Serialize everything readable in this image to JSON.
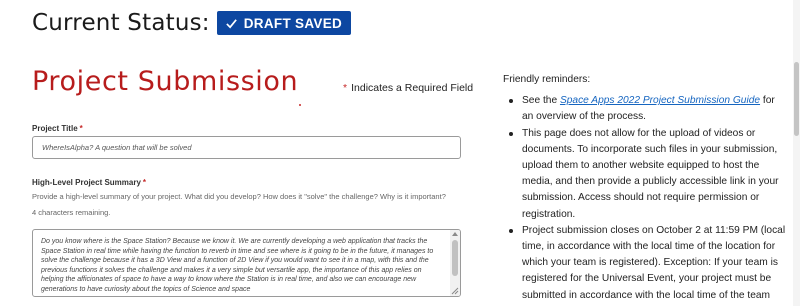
{
  "status": {
    "label": "Current Status:",
    "badge": "DRAFT SAVED",
    "badge_icon": "check-icon",
    "badge_color": "#0d47a1"
  },
  "page_title": "Project Submission",
  "required_note": {
    "star": "*",
    "text": "Indicates a Required Field"
  },
  "form": {
    "project_title": {
      "label": "Project Title",
      "star": "*",
      "value": "WhereIsAlpha? A question that will be solved"
    },
    "summary": {
      "label": "High-Level Project Summary",
      "star": "*",
      "helper": "Provide a high-level summary of your project. What did you develop? How does it \"solve\" the challenge? Why is it important?",
      "chars_remaining": "4 characters remaining.",
      "value": "Do you know where is the Space Station? Because we know it. We are currently developing a web application that tracks the Space Station in real time while having the function to reverb in time and see where is it going to be in the future, it manages to solve the challenge because it has a 3D View and a function of 2D View if you would want to see it in a map, with this and the previous functions it solves the challenge and makes it a very simple but versartile app, the importance of this app relies on helping the afficionates of space to have a way to know where the Station is in real time, and also we can encourage new generations to have curiosity about the topics of Science and space"
    }
  },
  "reminders": {
    "heading": "Friendly reminders:",
    "items": [
      {
        "before": "See the ",
        "link": "Space Apps 2022 Project Submission Guide",
        "after": " for an overview of the process."
      },
      {
        "text": "This page does not allow for the upload of videos or documents. To incorporate such files in your submission, upload them to another website equipped to host the media, and then provide a publicly accessible link in your submission. Access should not require permission or registration."
      },
      {
        "text": "Project submission closes on October 2 at 11:59 PM (local time, in accordance with the local time of the location for which your team is registered). Exception: If your team is registered for the Universal Event, your project must be submitted in accordance with the local time of the team member who created your team."
      }
    ]
  },
  "colors": {
    "title_red": "#b71c1c",
    "link_blue": "#1565c0",
    "required_star": "#c62828"
  }
}
